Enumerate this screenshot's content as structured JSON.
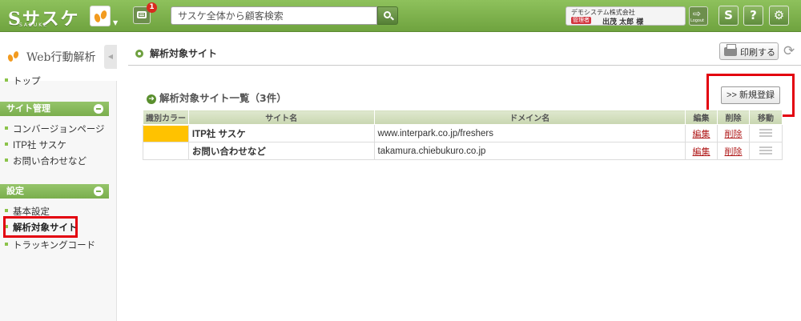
{
  "app": {
    "logo_text": "Sサスケ",
    "logo_sub": "SASUKE",
    "notifications_count": "1",
    "search_placeholder": "サスケ全体から顧客検索",
    "user": {
      "company": "デモシステム株式会社",
      "role": "管理者",
      "name": "出茂 太郎 様"
    },
    "logout_label": "Logout",
    "buttons": {
      "sasuke": "S",
      "help": "?",
      "settings": "⚙"
    }
  },
  "sidebar": {
    "title": "Web行動解析",
    "top_link": "トップ",
    "sections": [
      {
        "label": "サイト管理",
        "items": [
          "コンバージョンページ",
          "ITP社 サスケ",
          "お問い合わせなど"
        ]
      },
      {
        "label": "設定",
        "items": [
          "基本設定",
          "解析対象サイト",
          "トラッキングコード"
        ]
      }
    ],
    "active_item": "解析対象サイト"
  },
  "main": {
    "page_title": "解析対象サイト",
    "print_label": "印刷する",
    "list_title": "解析対象サイト一覧（3件）",
    "new_button": ">> 新規登録",
    "table": {
      "headers": [
        "識別カラー",
        "サイト名",
        "ドメイン名",
        "編集",
        "削除",
        "移動"
      ],
      "rows": [
        {
          "color": "#ffc200",
          "site": "ITP社 サスケ",
          "domain": "www.interpark.co.jp/freshers",
          "edit": "編集",
          "delete": "削除"
        },
        {
          "color": "#ffffff",
          "site": "お問い合わせなど",
          "domain": "takamura.chiebukuro.co.jp",
          "edit": "編集",
          "delete": "削除"
        }
      ]
    }
  },
  "colors": {
    "brand_green": "#7aae4d",
    "highlight_red": "#e3000f"
  }
}
